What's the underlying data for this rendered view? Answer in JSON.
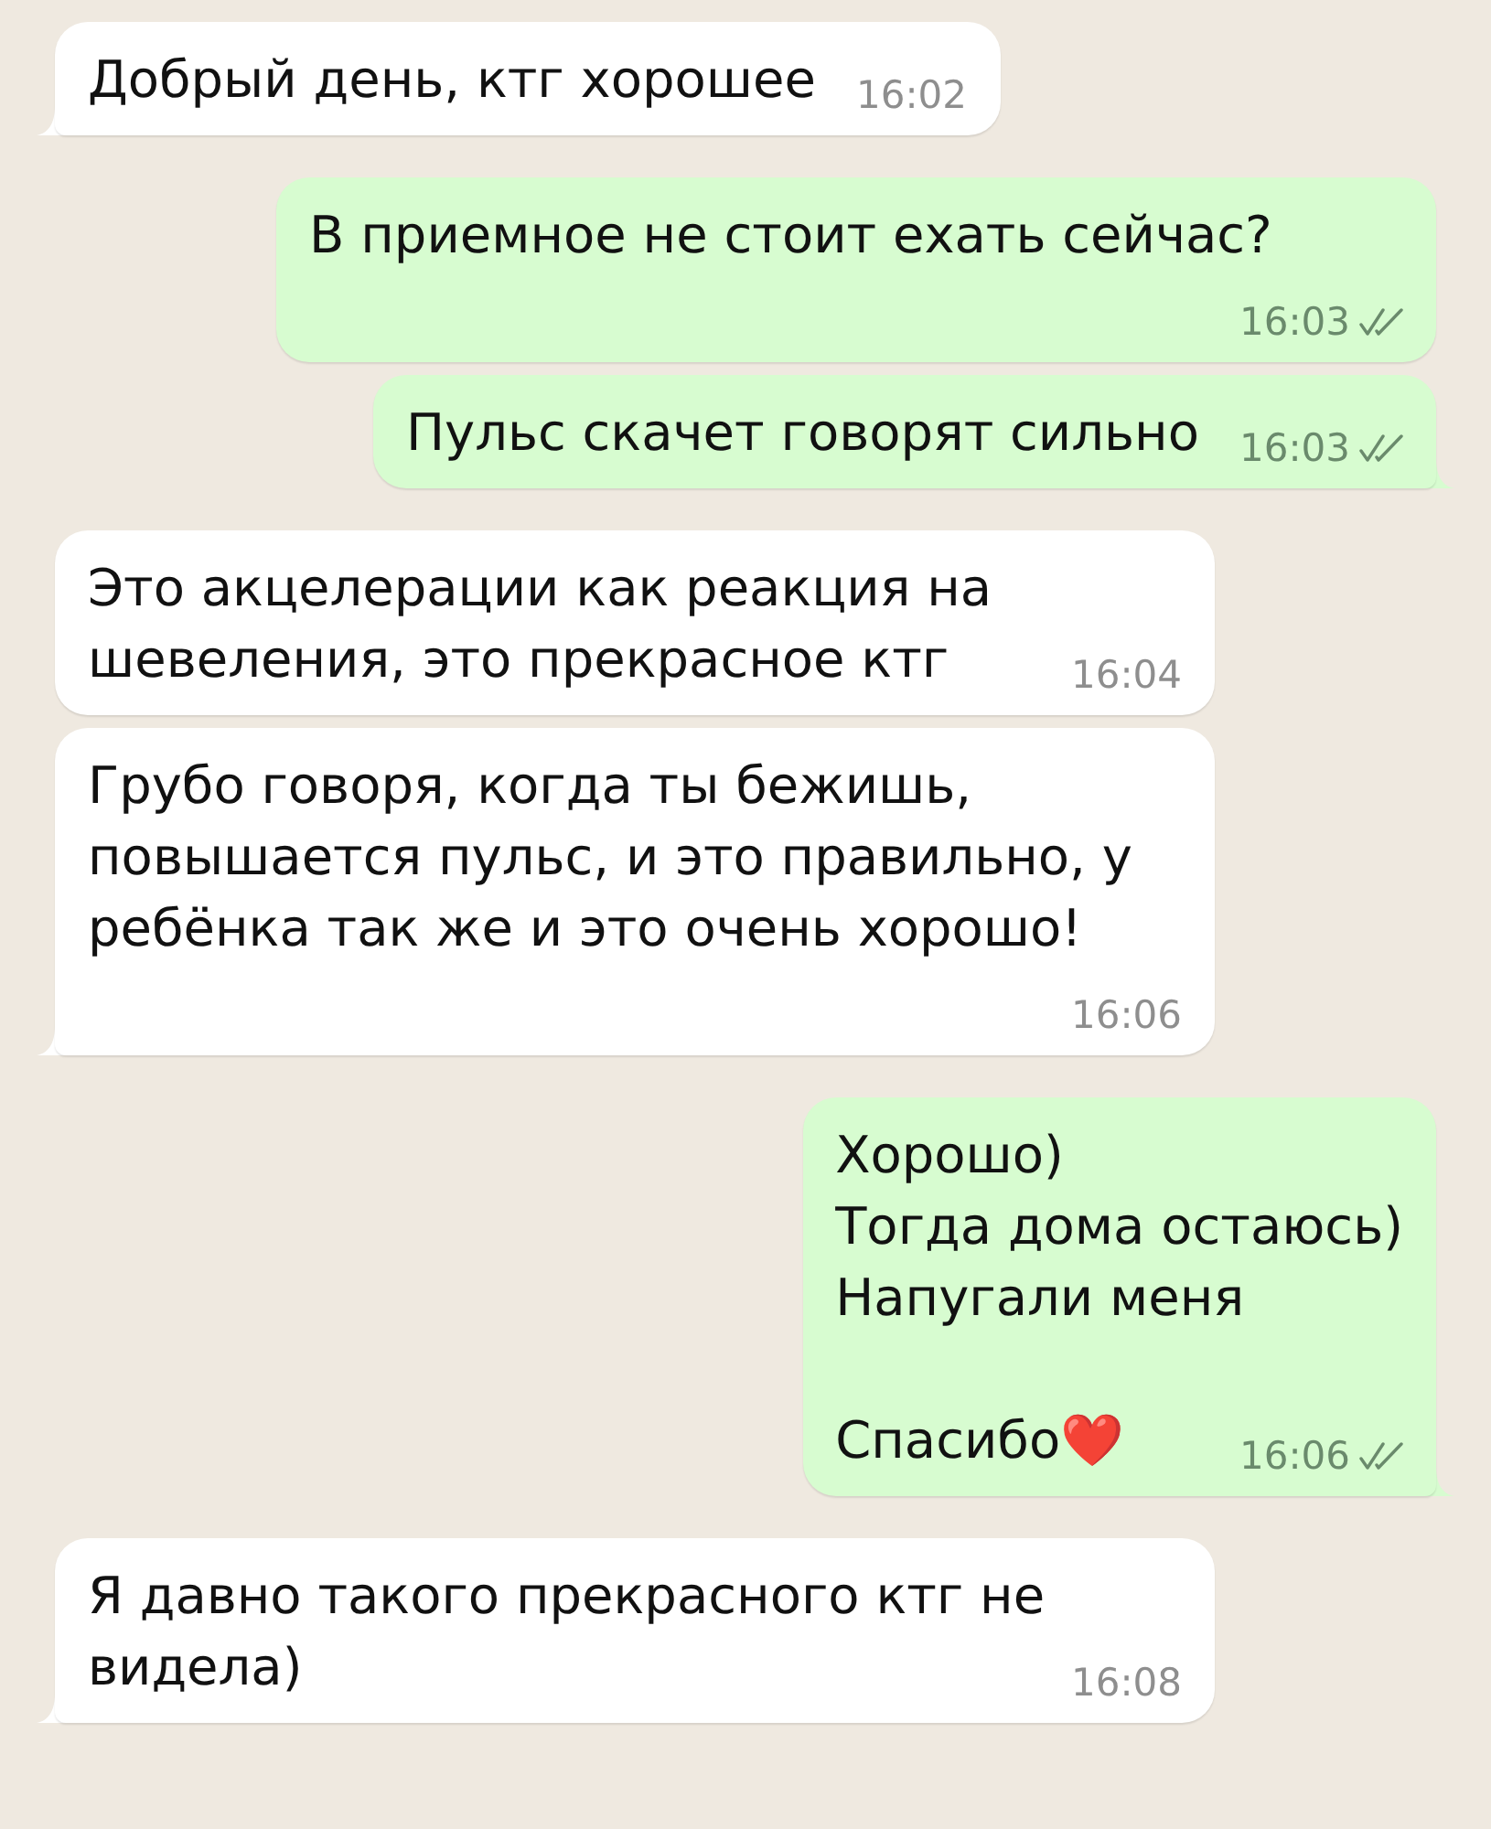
{
  "messages": [
    {
      "kind": "incoming",
      "paragraphs": [
        "Добрый день, ктг хорошее"
      ],
      "time": "16:02",
      "tail": true
    },
    {
      "kind": "outgoing",
      "paragraphs": [
        "В приемное не стоит ехать сейчас?"
      ],
      "time": "16:03",
      "delivered": true,
      "read": false,
      "tail": false
    },
    {
      "kind": "outgoing",
      "paragraphs": [
        "Пульс скачет говорят сильно"
      ],
      "time": "16:03",
      "delivered": true,
      "read": false,
      "tail": true
    },
    {
      "kind": "incoming",
      "paragraphs": [
        "Это акцелерации как реакция на шевеления, это прекрасное ктг"
      ],
      "time": "16:04",
      "tail": false
    },
    {
      "kind": "incoming",
      "paragraphs": [
        "Грубо говоря, когда ты бежишь, повышается пульс, и это правильно, у ребёнка так же и это очень хорошо!"
      ],
      "time": "16:06",
      "tail": true
    },
    {
      "kind": "outgoing",
      "paragraphs": [
        "Хорошо)\nТогда дома остаюсь)\nНапугали меня",
        "Спасибо"
      ],
      "emoji": "❤️",
      "time": "16:06",
      "delivered": true,
      "read": false,
      "tail": true
    },
    {
      "kind": "incoming",
      "paragraphs": [
        "Я давно такого прекрасного ктг не видела)"
      ],
      "time": "16:08",
      "tail": true
    }
  ]
}
